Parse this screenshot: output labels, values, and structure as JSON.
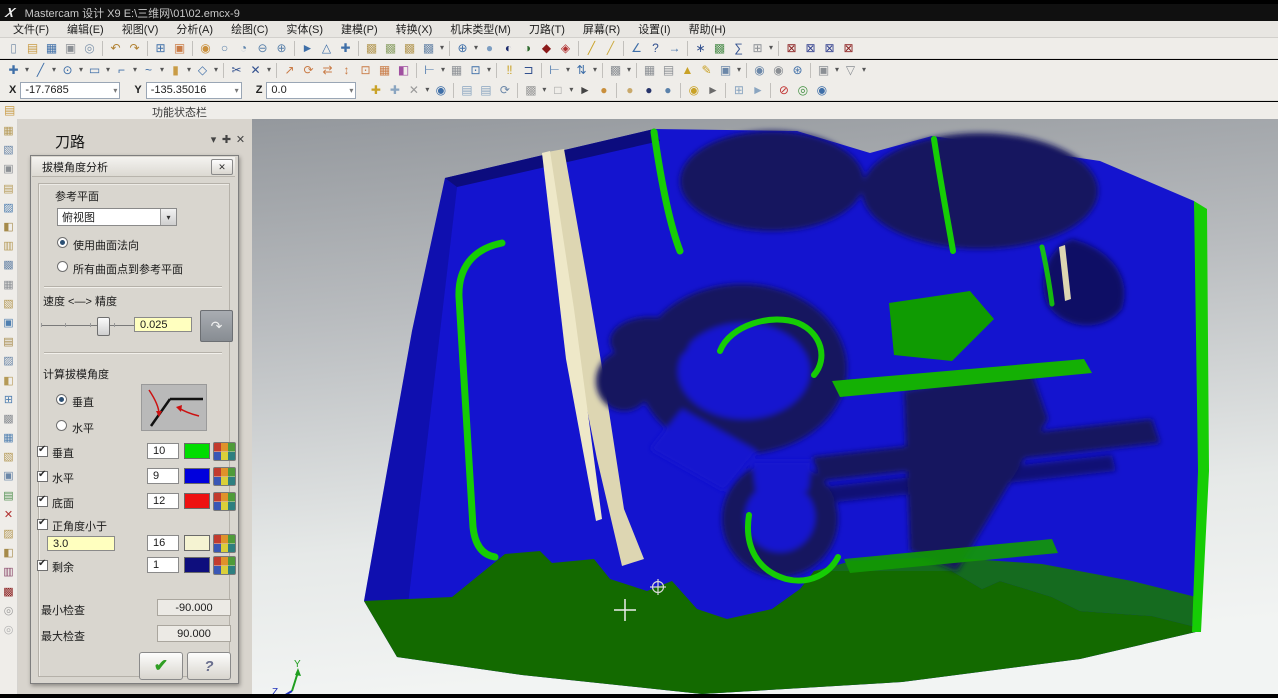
{
  "window": {
    "logo": "X",
    "title": "Mastercam 设计 X9   E:\\三维网\\01\\02.emcx-9"
  },
  "menu": {
    "items": [
      {
        "label": "文件(F)"
      },
      {
        "label": "编辑(E)"
      },
      {
        "label": "视图(V)"
      },
      {
        "label": "分析(A)"
      },
      {
        "label": "绘图(C)"
      },
      {
        "label": "实体(S)"
      },
      {
        "label": "建模(P)"
      },
      {
        "label": "转换(X)"
      },
      {
        "label": "机床类型(M)"
      },
      {
        "label": "刀路(T)"
      },
      {
        "label": "屏幕(R)"
      },
      {
        "label": "设置(I)"
      },
      {
        "label": "帮助(H)"
      }
    ]
  },
  "toolbar1": {
    "icons": [
      {
        "n": "new-file-icon",
        "g": "▯",
        "c": "#7d93ab"
      },
      {
        "n": "open-file-icon",
        "g": "▤",
        "c": "#c99c46"
      },
      {
        "n": "save-icon",
        "g": "▦",
        "c": "#3f6fa8"
      },
      {
        "n": "print-icon",
        "g": "▣",
        "c": "#8b8f94"
      },
      {
        "n": "print-preview-icon",
        "g": "◎",
        "c": "#7d93ab"
      },
      {
        "n": "sep"
      },
      {
        "n": "undo-icon",
        "g": "↶",
        "c": "#b08030"
      },
      {
        "n": "redo-icon",
        "g": "↷",
        "c": "#b08030"
      },
      {
        "n": "sep"
      },
      {
        "n": "viewsheets-icon",
        "g": "⊞",
        "c": "#3f6fa8"
      },
      {
        "n": "capture-icon",
        "g": "▣",
        "c": "#c97b46"
      },
      {
        "n": "sep"
      },
      {
        "n": "zoom-dynamic-icon",
        "g": "◉",
        "c": "#c98f3c"
      },
      {
        "n": "zoom-window-icon",
        "g": "○",
        "c": "#5b82ab"
      },
      {
        "n": "zoom-target-icon",
        "g": "◔",
        "c": "#5b82ab"
      },
      {
        "n": "zoom-out-icon",
        "g": "⊖",
        "c": "#5b82ab"
      },
      {
        "n": "zoom-in-icon",
        "g": "⊕",
        "c": "#5b82ab"
      },
      {
        "n": "sep"
      },
      {
        "n": "pan-icon",
        "g": "►",
        "c": "#3f6fa8"
      },
      {
        "n": "rotate-view-icon",
        "g": "△",
        "c": "#3f6fa8"
      },
      {
        "n": "orient-view-icon",
        "g": "✚",
        "c": "#3f6fa8"
      },
      {
        "n": "sep"
      },
      {
        "n": "iso-view-icon",
        "g": "▩",
        "c": "#b59a57"
      },
      {
        "n": "front-view-icon",
        "g": "▩",
        "c": "#8fa36b"
      },
      {
        "n": "top-view-icon",
        "g": "▩",
        "c": "#b59a57"
      },
      {
        "n": "right-view-icon",
        "g": "▩",
        "c": "#6b87a8"
      },
      {
        "n": "view-menu-icon",
        "g": "▾",
        "c": "#555555",
        "dd": 1
      },
      {
        "n": "sep"
      },
      {
        "n": "wcs-icon",
        "g": "⊕",
        "c": "#3f6fa8"
      },
      {
        "n": "wcs-menu-icon",
        "g": "▾",
        "c": "#555555",
        "dd": 1
      },
      {
        "n": "sphere-icon",
        "g": "●",
        "c": "#7d9ec2"
      },
      {
        "n": "shade-dark-icon",
        "g": "◐",
        "c": "#1b2a6b"
      },
      {
        "n": "shade-green-icon",
        "g": "◑",
        "c": "#2f6b2f"
      },
      {
        "n": "hatch-red-icon",
        "g": "◆",
        "c": "#8b1a1a"
      },
      {
        "n": "hatch-red2-icon",
        "g": "◈",
        "c": "#b03030"
      },
      {
        "n": "sep"
      },
      {
        "n": "line-style-icon",
        "g": "╱",
        "c": "#c9a227"
      },
      {
        "n": "line-width-icon",
        "g": "╱",
        "c": "#caa93f"
      },
      {
        "n": "sep"
      },
      {
        "n": "analyze-position-icon",
        "g": "∠",
        "c": "#3f6fa8"
      },
      {
        "n": "analyze-help-icon",
        "g": "?",
        "c": "#33518f"
      },
      {
        "n": "analyze-distance-icon",
        "g": "→",
        "c": "#3f6fa8"
      },
      {
        "n": "sep"
      },
      {
        "n": "analyze-chain-icon",
        "g": "∗",
        "c": "#33518f"
      },
      {
        "n": "analyze-surface-icon",
        "g": "▩",
        "c": "#4f8f4f"
      },
      {
        "n": "analyze-stats-icon",
        "g": "∑",
        "c": "#33518f"
      },
      {
        "n": "analyze-menu-icon",
        "g": "⊞",
        "c": "#8b8f94"
      },
      {
        "n": "analyze-menu-arrow-icon",
        "g": "▾",
        "c": "#555555",
        "dd": 1
      },
      {
        "n": "sep"
      },
      {
        "n": "solids-check1-icon",
        "g": "⊠",
        "c": "#8b2020"
      },
      {
        "n": "solids-check2-icon",
        "g": "⊠",
        "c": "#33418f"
      },
      {
        "n": "solids-check3-icon",
        "g": "⊠",
        "c": "#33418f"
      },
      {
        "n": "solids-check4-icon",
        "g": "⊠",
        "c": "#8b2020"
      }
    ]
  },
  "toolbar2": {
    "icons": [
      {
        "n": "point-create-icon",
        "g": "✚",
        "c": "#3f6fa8"
      },
      {
        "n": "point-menu-icon",
        "g": "▾",
        "c": "#555",
        "dd": 1
      },
      {
        "n": "line-create-icon",
        "g": "╱",
        "c": "#3f6fa8"
      },
      {
        "n": "line-menu-icon",
        "g": "▾",
        "c": "#555",
        "dd": 1
      },
      {
        "n": "circle-create-icon",
        "g": "⊙",
        "c": "#3f6fa8"
      },
      {
        "n": "circle-menu-icon",
        "g": "▾",
        "c": "#555",
        "dd": 1
      },
      {
        "n": "rect-create-icon",
        "g": "▭",
        "c": "#3f6fa8"
      },
      {
        "n": "rect-menu-icon",
        "g": "▾",
        "c": "#555",
        "dd": 1
      },
      {
        "n": "fillet-create-icon",
        "g": "⌐",
        "c": "#3f6fa8"
      },
      {
        "n": "fillet-menu-icon",
        "g": "▾",
        "c": "#555",
        "dd": 1
      },
      {
        "n": "spline-create-icon",
        "g": "~",
        "c": "#3f6fa8"
      },
      {
        "n": "spline-menu-icon",
        "g": "▾",
        "c": "#555",
        "dd": 1
      },
      {
        "n": "solid-create-icon",
        "g": "▮",
        "c": "#c99c46"
      },
      {
        "n": "solid-menu-icon",
        "g": "▾",
        "c": "#555",
        "dd": 1
      },
      {
        "n": "drafting-icon",
        "g": "◇",
        "c": "#3f6fa8"
      },
      {
        "n": "drafting-menu-icon",
        "g": "▾",
        "c": "#555",
        "dd": 1
      },
      {
        "n": "sep"
      },
      {
        "n": "trim-icon",
        "g": "✂",
        "c": "#33518f"
      },
      {
        "n": "delete-icon",
        "g": "✕",
        "c": "#33518f"
      },
      {
        "n": "delete-menu-icon",
        "g": "▾",
        "c": "#555",
        "dd": 1
      },
      {
        "n": "sep"
      },
      {
        "n": "xform-translate-icon",
        "g": "↗",
        "c": "#c97b46"
      },
      {
        "n": "xform-rotate-icon",
        "g": "⟳",
        "c": "#c97b46"
      },
      {
        "n": "xform-mirror-icon",
        "g": "⇄",
        "c": "#c97b46"
      },
      {
        "n": "xform-offset-icon",
        "g": "↕",
        "c": "#c97b46"
      },
      {
        "n": "xform-scale-icon",
        "g": "⊡",
        "c": "#c97b46"
      },
      {
        "n": "xform-array-icon",
        "g": "▦",
        "c": "#c97b46"
      },
      {
        "n": "xform-project-icon",
        "g": "◧",
        "c": "#a04fa0"
      },
      {
        "n": "sep"
      },
      {
        "n": "dim-horizontal-icon",
        "g": "⊢",
        "c": "#3f6fa8"
      },
      {
        "n": "dim-menu-icon",
        "g": "▾",
        "c": "#555",
        "dd": 1
      },
      {
        "n": "pattern-icon",
        "g": "▦",
        "c": "#8b8f94"
      },
      {
        "n": "frame-icon",
        "g": "⊡",
        "c": "#3f6fa8"
      },
      {
        "n": "frame-menu-icon",
        "g": "▾",
        "c": "#555",
        "dd": 1
      },
      {
        "n": "sep"
      },
      {
        "n": "note-icon",
        "g": "‼",
        "c": "#c9a227"
      },
      {
        "n": "flag-icon",
        "g": "⊐",
        "c": "#33518f"
      },
      {
        "n": "sep"
      },
      {
        "n": "measure-h-icon",
        "g": "⊢",
        "c": "#3f6fa8"
      },
      {
        "n": "measure-h-menu-icon",
        "g": "▾",
        "c": "#555",
        "dd": 1
      },
      {
        "n": "measure-v-icon",
        "g": "⇅",
        "c": "#3f6fa8"
      },
      {
        "n": "measure-v-menu-icon",
        "g": "▾",
        "c": "#555",
        "dd": 1
      },
      {
        "n": "sep"
      },
      {
        "n": "hatch-icon",
        "g": "▩",
        "c": "#8b8f94"
      },
      {
        "n": "hatch-menu-icon",
        "g": "▾",
        "c": "#555",
        "dd": 1
      },
      {
        "n": "sep"
      },
      {
        "n": "grid-icon",
        "g": "▦",
        "c": "#8b8f94"
      },
      {
        "n": "mesh-icon",
        "g": "▤",
        "c": "#8b8f94"
      },
      {
        "n": "cone-icon",
        "g": "▲",
        "c": "#c9a227"
      },
      {
        "n": "pencil-icon",
        "g": "✎",
        "c": "#c9a227"
      },
      {
        "n": "holder-icon",
        "g": "▣",
        "c": "#6b87a8"
      },
      {
        "n": "holder-menu-icon",
        "g": "▾",
        "c": "#555",
        "dd": 1
      },
      {
        "n": "sep"
      },
      {
        "n": "ball1-icon",
        "g": "◉",
        "c": "#6b87a8"
      },
      {
        "n": "ball2-icon",
        "g": "◉",
        "c": "#8b8f94"
      },
      {
        "n": "net-icon",
        "g": "⊛",
        "c": "#3f6fa8"
      },
      {
        "n": "sep"
      },
      {
        "n": "sheet-icon",
        "g": "▣",
        "c": "#8b8f94"
      },
      {
        "n": "sheet-menu-icon",
        "g": "▾",
        "c": "#555",
        "dd": 1
      },
      {
        "n": "funnel-icon",
        "g": "▽",
        "c": "#8b8f94"
      },
      {
        "n": "funnel-menu-icon",
        "g": "▾",
        "c": "#555",
        "dd": 1
      }
    ]
  },
  "coords": {
    "x_label": "X",
    "x_value": "-17.7685",
    "y_label": "Y",
    "y_value": "-135.35016",
    "z_label": "Z",
    "z_value": "0.0"
  },
  "toolbar3": {
    "icons": [
      {
        "n": "origin-icon",
        "g": "✚",
        "c": "#c9a227"
      },
      {
        "n": "axis-icon",
        "g": "✚",
        "c": "#8aa5c0"
      },
      {
        "n": "clear-icon",
        "g": "✕",
        "c": "#9a9a9a"
      },
      {
        "n": "clear-menu-icon",
        "g": "▾",
        "c": "#555",
        "dd": 1
      },
      {
        "n": "help-icon",
        "g": "◉",
        "c": "#3f6fa8"
      },
      {
        "n": "sep"
      },
      {
        "n": "copy-entity-icon",
        "g": "▤",
        "c": "#8aa5c0"
      },
      {
        "n": "paste-entity-icon",
        "g": "▤",
        "c": "#8aa5c0"
      },
      {
        "n": "regen-icon",
        "g": "⟳",
        "c": "#6b87a8"
      },
      {
        "n": "sep"
      },
      {
        "n": "grid-snap-icon",
        "g": "▩",
        "c": "#9a9a9a"
      },
      {
        "n": "grid-snap-menu-icon",
        "g": "▾",
        "c": "#555",
        "dd": 1
      },
      {
        "n": "selection-box-icon",
        "g": "□",
        "c": "#9a9a9a"
      },
      {
        "n": "selection-menu-icon",
        "g": "▾",
        "c": "#555",
        "dd": 1
      },
      {
        "n": "cursor-icon",
        "g": "►",
        "c": "#444444"
      },
      {
        "n": "ball-orange-icon",
        "g": "●",
        "c": "#c98f3c"
      },
      {
        "n": "sep"
      },
      {
        "n": "ball-tan-icon",
        "g": "●",
        "c": "#c9a96b"
      },
      {
        "n": "ball-navy-icon",
        "g": "●",
        "c": "#27346b"
      },
      {
        "n": "ball-blue-icon",
        "g": "●",
        "c": "#5b82ab"
      },
      {
        "n": "sep"
      },
      {
        "n": "ball-select-icon",
        "g": "◉",
        "c": "#c9a227"
      },
      {
        "n": "pick-icon",
        "g": "►",
        "c": "#6b6b6b"
      },
      {
        "n": "sep"
      },
      {
        "n": "grid-ball-icon",
        "g": "⊞",
        "c": "#8aa5c0"
      },
      {
        "n": "pick-doc-icon",
        "g": "►",
        "c": "#8aa5c0"
      },
      {
        "n": "sep"
      },
      {
        "n": "no-entry-icon",
        "g": "⊘",
        "c": "#c03030"
      },
      {
        "n": "ok-circle-icon",
        "g": "◎",
        "c": "#3f8f3f"
      },
      {
        "n": "info-circle-icon",
        "g": "◉",
        "c": "#3f6fa8"
      }
    ]
  },
  "status_hint": "功能状态栏",
  "left_toolbar": {
    "icons": [
      {
        "n": "lt-tool-1-icon",
        "g": "▦",
        "c": "#b59a57"
      },
      {
        "n": "lt-tool-2-icon",
        "g": "▧",
        "c": "#6b87a8"
      },
      {
        "n": "lt-tool-3-icon",
        "g": "▣",
        "c": "#8b8f94"
      },
      {
        "n": "lt-tool-4-icon",
        "g": "▤",
        "c": "#b59a57"
      },
      {
        "n": "lt-tool-5-icon",
        "g": "▨",
        "c": "#4f7fb0"
      },
      {
        "n": "lt-tool-6-icon",
        "g": "◧",
        "c": "#a58a4a"
      },
      {
        "n": "lt-tool-7-icon",
        "g": "▥",
        "c": "#b59a57"
      },
      {
        "n": "lt-tool-8-icon",
        "g": "▩",
        "c": "#6b87a8"
      },
      {
        "n": "lt-tool-9-icon",
        "g": "▦",
        "c": "#8b8f94"
      },
      {
        "n": "lt-tool-10-icon",
        "g": "▧",
        "c": "#b59a57"
      },
      {
        "n": "lt-tool-11-icon",
        "g": "▣",
        "c": "#4f7fb0"
      },
      {
        "n": "lt-tool-12-icon",
        "g": "▤",
        "c": "#a58a4a"
      },
      {
        "n": "lt-tool-13-icon",
        "g": "▨",
        "c": "#6b87a8"
      },
      {
        "n": "lt-tool-14-icon",
        "g": "◧",
        "c": "#b59a57"
      },
      {
        "n": "lt-tool-15-icon",
        "g": "⊞",
        "c": "#4f7fb0"
      },
      {
        "n": "lt-tool-16-icon",
        "g": "▩",
        "c": "#8b8f94"
      },
      {
        "n": "lt-tool-17-icon",
        "g": "▦",
        "c": "#4f7fb0"
      },
      {
        "n": "lt-tool-18-icon",
        "g": "▧",
        "c": "#b59a57"
      },
      {
        "n": "lt-tool-19-icon",
        "g": "▣",
        "c": "#6b87a8"
      },
      {
        "n": "lt-tool-20-icon",
        "g": "▤",
        "c": "#4f8f4f"
      },
      {
        "n": "lt-delete-icon",
        "g": "✕",
        "c": "#b03030"
      },
      {
        "n": "lt-tool-22-icon",
        "g": "▨",
        "c": "#b59a57"
      },
      {
        "n": "lt-tool-23-icon",
        "g": "◧",
        "c": "#a58a4a"
      },
      {
        "n": "lt-tool-24-icon",
        "g": "▥",
        "c": "#8b4a6b"
      },
      {
        "n": "lt-tool-25-icon",
        "g": "▩",
        "c": "#8b2020"
      },
      {
        "n": "lt-tool-26-icon",
        "g": "◎",
        "c": "#9a9a9a"
      },
      {
        "n": "lt-tool-27-icon",
        "g": "◎",
        "c": "#b0b0b0"
      }
    ]
  },
  "panel": {
    "title": "刀路",
    "collapse": "▾",
    "pin": "✚",
    "close": "✕"
  },
  "dialog": {
    "title": "拔模角度分析",
    "close": "✕",
    "ref_plane_label": "参考平面",
    "ref_plane_value": "俯视图",
    "combo_arrow": "▾",
    "radio_surface_normal": "使用曲面法向",
    "radio_points_to_plane": "所有曲面点到参考平面",
    "slider_label": "速度 <—> 精度",
    "slider_value": "0.025",
    "calc_label": "计算拔模角度",
    "radio_vertical": "垂直",
    "radio_horizontal": "水平",
    "check_glyph": "✔",
    "rows": [
      {
        "label": "垂直",
        "value": "10",
        "color": "#00dd00"
      },
      {
        "label": "水平",
        "value": "9",
        "color": "#0000dd"
      },
      {
        "label": "底面",
        "value": "12",
        "color": "#ee1111"
      },
      {
        "label": "正角度小于",
        "value": "16",
        "color": "#f5f3d2",
        "extra": "3.0"
      },
      {
        "label": "剩余",
        "value": "1",
        "color": "#0e0e7d"
      }
    ],
    "min_label": "最小检查",
    "min_value": "-90.000",
    "max_label": "最大检查",
    "max_value": "90.000",
    "ok": "✔",
    "help": "?"
  },
  "viewport": {
    "gizmo_y": "Y",
    "gizmo_z": "Z"
  },
  "colors": {
    "model_blue": "#1414cf",
    "model_navy": "#13135e",
    "model_green_base": "#136a00",
    "model_green_accent": "#16cd05",
    "model_cream": "#ddd6b2",
    "field_yellow": "#ffffbf"
  }
}
